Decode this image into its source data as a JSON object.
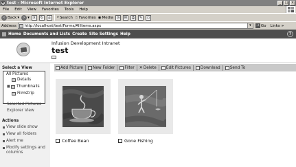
{
  "window": {
    "title": "test - Microsoft Internet Explorer",
    "controls": [
      "_",
      "□",
      "×"
    ]
  },
  "menu": [
    "File",
    "Edit",
    "View",
    "Favorites",
    "Tools",
    "Help"
  ],
  "toolbar": {
    "back": "Back",
    "search": "Search",
    "favorites": "Favorites",
    "media": "Media"
  },
  "address": {
    "label": "Address",
    "url": "http://localhost/test/Forms/AllItems.aspx",
    "go": "Go",
    "links": "Links"
  },
  "topnav": [
    "Home",
    "Documents and Lists",
    "Create",
    "Site Settings",
    "Help"
  ],
  "header": {
    "site": "Infusion Development Intranet",
    "title": "test"
  },
  "sidebar": {
    "select_view_heading": "Select a View",
    "views": [
      "All Pictures",
      "Details",
      "Thumbnails",
      "Filmstrip"
    ],
    "links": [
      "Selected Pictures",
      "Explorer View"
    ],
    "actions_heading": "Actions",
    "actions": [
      "View slide show",
      "View all folders",
      "Alert me",
      "Modify settings and columns"
    ]
  },
  "commands": [
    "Add Picture",
    "New Folder",
    "Filter",
    "Delete",
    "Edit Pictures",
    "Download",
    "Send To"
  ],
  "pictures": [
    {
      "name": "Coffee Bean"
    },
    {
      "name": "Gone Fishing"
    }
  ]
}
